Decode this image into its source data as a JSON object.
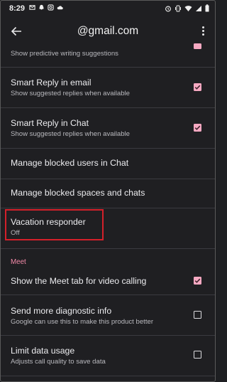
{
  "status": {
    "time": "8:29"
  },
  "header": {
    "account": "@gmail.com"
  },
  "items": [
    {
      "subtitle": "Show predictive writing suggestions",
      "checked": true
    },
    {
      "title": "Smart Reply in email",
      "subtitle": "Show suggested replies when available",
      "checked": true
    },
    {
      "title": "Smart Reply in Chat",
      "subtitle": "Show suggested replies when available",
      "checked": true
    },
    {
      "title": "Manage blocked users in Chat"
    },
    {
      "title": "Manage blocked spaces and chats"
    },
    {
      "title": "Vacation responder",
      "subtitle": "Off"
    }
  ],
  "meet": {
    "section_label": "Meet",
    "items": [
      {
        "title": "Show the Meet tab for video calling",
        "checked": true
      },
      {
        "title": "Send more diagnostic info",
        "subtitle": "Google can use this to make this product better",
        "checked": false
      },
      {
        "title": "Limit data usage",
        "subtitle": "Adjusts call quality to save data",
        "checked": false
      }
    ]
  },
  "colors": {
    "accent": "#f6a9c2",
    "section": "#f38aa8",
    "highlight": "#d4202a",
    "background": "#1f1f22"
  }
}
